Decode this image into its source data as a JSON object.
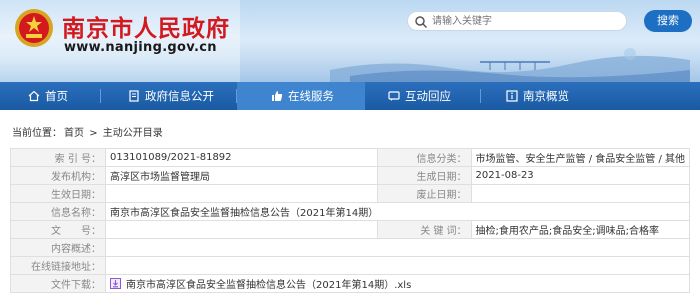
{
  "header": {
    "site_title": "南京市人民政府",
    "site_url": "www.nanjing.gov.cn",
    "search_placeholder": "请输入关键字",
    "search_button": "搜索"
  },
  "nav": {
    "items": [
      {
        "label": "首页",
        "icon": "home-icon"
      },
      {
        "label": "政府信息公开",
        "icon": "document-icon"
      },
      {
        "label": "在线服务",
        "icon": "thumbs-up-icon",
        "active": true
      },
      {
        "label": "互动回应",
        "icon": "chat-icon"
      },
      {
        "label": "南京概览",
        "icon": "info-icon"
      }
    ]
  },
  "breadcrumb": {
    "prefix": "当前位置：",
    "home": "首页",
    "sep": ">",
    "current": "主动公开目录"
  },
  "info": {
    "index_label": "索 引 号：",
    "index_value": "013101089/2021-81892",
    "category_label": "信息分类：",
    "category_value": "市场监管、安全生产监管 / 食品安全监管 / 其他",
    "publisher_label": "发布机构：",
    "publisher_value": "高淳区市场监督管理局",
    "created_label": "生成日期：",
    "created_value": "2021-08-23",
    "effective_label": "生效日期：",
    "effective_value": "",
    "repeal_label": "废止日期：",
    "repeal_value": "",
    "name_label": "信息名称：",
    "name_value": "南京市高淳区食品安全监督抽检信息公告（2021年第14期）",
    "docno_label": "文　　号：",
    "docno_value": "",
    "keywords_label": "关 键 词：",
    "keywords_value": "抽检;食用农产品;食品安全;调味品;合格率",
    "overview_label": "内容概述：",
    "overview_value": "",
    "link_label": "在线链接地址：",
    "link_value": "",
    "download_label": "文件下载：",
    "download_value": "南京市高淳区食品安全监督抽检信息公告（2021年第14期）.xls"
  },
  "colors": {
    "title_red": "#d3181e",
    "nav_blue": "#1e5fa8",
    "nav_active": "#3f84cf",
    "search_button": "#1d6fc4"
  }
}
